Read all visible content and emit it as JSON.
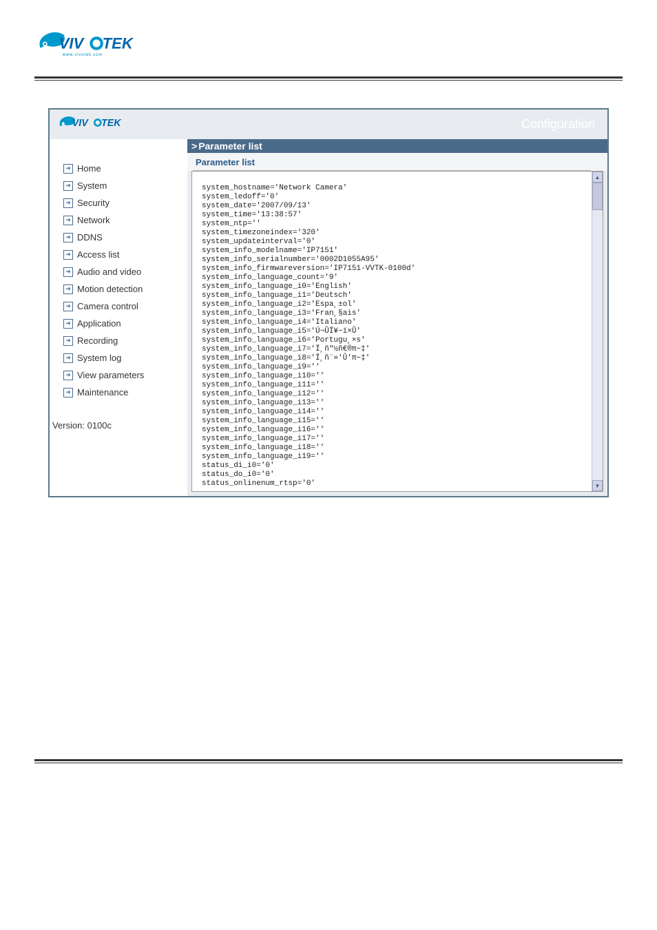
{
  "logo_text": "VIVOTEK",
  "logo_sub": "www.vivotek.com",
  "header": {
    "config_label": "Configuration"
  },
  "sidebar": {
    "items": [
      {
        "label": "Home"
      },
      {
        "label": "System"
      },
      {
        "label": "Security"
      },
      {
        "label": "Network"
      },
      {
        "label": "DDNS"
      },
      {
        "label": "Access list"
      },
      {
        "label": "Audio and video"
      },
      {
        "label": "Motion detection"
      },
      {
        "label": "Camera control"
      },
      {
        "label": "Application"
      },
      {
        "label": "Recording"
      },
      {
        "label": "System log"
      },
      {
        "label": "View parameters"
      },
      {
        "label": "Maintenance"
      }
    ],
    "version": "Version: 0100c"
  },
  "content": {
    "section_title": "Parameter list",
    "sub_title": "Parameter list",
    "parameters": "system_hostname='Network Camera'\nsystem_ledoff='0'\nsystem_date='2007/09/13'\nsystem_time='13:38:57'\nsystem_ntp=''\nsystem_timezoneindex='320'\nsystem_updateinterval='0'\nsystem_info_modelname='IP7151'\nsystem_info_serialnumber='0002D1055A95'\nsystem_info_firmwareversion='IP7151-VVTK-0100d'\nsystem_info_language_count='9'\nsystem_info_language_i0='English'\nsystem_info_language_i1='Deutsch'\nsystem_info_language_i2='Espa¸±ol'\nsystem_info_language_i3='Fran¸§ais'\nsystem_info_language_i4='Italiano'\nsystem_info_language_i5='Ú¬ÛÏ¥−ï×Û'\nsystem_info_language_i6='Portugu¸×s'\nsystem_info_language_i7='Ï¸ñ\"½ñ€®π−‡'\nsystem_info_language_i8='Ï¸ñ¨»'Û'π−‡'\nsystem_info_language_i9=''\nsystem_info_language_i10=''\nsystem_info_language_i11=''\nsystem_info_language_i12=''\nsystem_info_language_i13=''\nsystem_info_language_i14=''\nsystem_info_language_i15=''\nsystem_info_language_i16=''\nsystem_info_language_i17=''\nsystem_info_language_i18=''\nsystem_info_language_i19=''\nstatus_di_i0='0'\nstatus_do_i0='0'\nstatus_onlinenum_rtsp='0'"
  }
}
